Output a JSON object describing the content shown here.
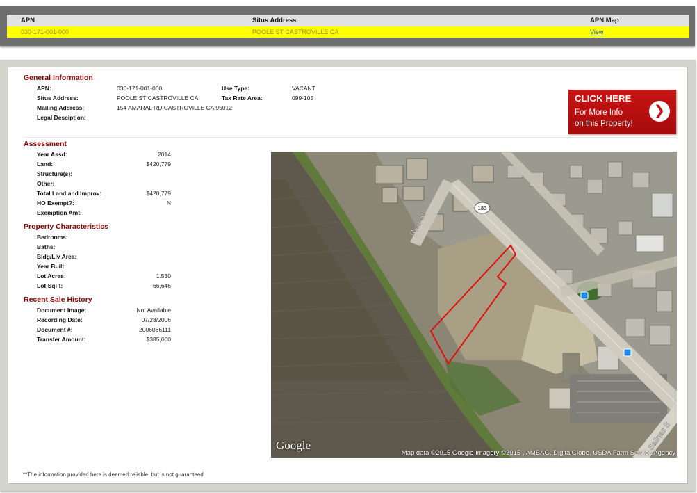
{
  "results": {
    "headers": {
      "apn": "APN",
      "situs": "Situs Address",
      "map": "APN Map"
    },
    "row": {
      "apn": "030-171-001-000",
      "situs": "POOLE ST CASTROVILLE CA",
      "map_link": "View"
    }
  },
  "general": {
    "title": "General Information",
    "apn_label": "APN:",
    "apn": "030-171-001-000",
    "situs_label": "Situs Address:",
    "situs": "POOLE ST CASTROVILLE CA",
    "mailing_label": "Mailing Address:",
    "mailing": "154 AMARAL RD CASTROVILLE CA 95012",
    "legal_label": "Legal Desciption:",
    "legal": "",
    "use_label": "Use Type:",
    "use": "VACANT",
    "tax_label": "Tax Rate Area:",
    "tax": "099-105"
  },
  "cta": {
    "heading": "CLICK HERE",
    "line1": "For More Info",
    "line2": "on this Property!",
    "arrow": "❯"
  },
  "assessment": {
    "title": "Assessment",
    "rows": [
      {
        "label": "Year Assd:",
        "value": "2014"
      },
      {
        "label": "Land:",
        "value": "$420,779"
      },
      {
        "label": "Structure(s):",
        "value": ""
      },
      {
        "label": "Other:",
        "value": ""
      },
      {
        "label": "Total Land and Improv:",
        "value": "$420,779"
      },
      {
        "label": "HO Exempt?:",
        "value": "N"
      },
      {
        "label": "Exemption Amt:",
        "value": ""
      }
    ]
  },
  "characteristics": {
    "title": "Property Characteristics",
    "rows": [
      {
        "label": "Bedrooms:",
        "value": ""
      },
      {
        "label": "Baths:",
        "value": ""
      },
      {
        "label": "Bldg/Liv Area:",
        "value": ""
      },
      {
        "label": "Year Built:",
        "value": ""
      },
      {
        "label": "Lot Acres:",
        "value": "1.530"
      },
      {
        "label": "Lot SqFt:",
        "value": "66,646"
      }
    ]
  },
  "sale": {
    "title": "Recent Sale History",
    "rows": [
      {
        "label": "Document Image:",
        "value": "Not Available"
      },
      {
        "label": "Recording Date:",
        "value": "07/28/2006"
      },
      {
        "label": "Document #:",
        "value": "2006066111"
      },
      {
        "label": "Transfer Amount:",
        "value": "$385,000"
      }
    ]
  },
  "map": {
    "logo": "Google",
    "attribution": "Map data ©2015 Google  Imagery ©2015 , AMBAG, DigitalGlobe, USDA Farm Service Agency",
    "street_rico": "Rico St",
    "route_shield": "183",
    "street_salinas": "Salinas S",
    "parcel_color": "#e01010"
  },
  "disclaimer": "**The information provided here is deemed reliable, but is not guaranteed."
}
